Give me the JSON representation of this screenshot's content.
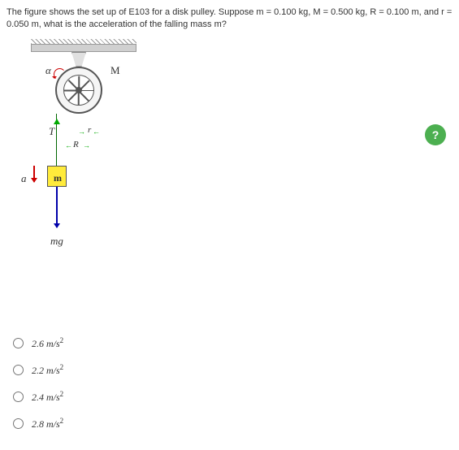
{
  "question": "The figure shows the set up of E103 for a disk pulley.  Suppose m = 0.100 kg, M = 0.500 kg, R = 0.100 m, and r = 0.050 m, what is the acceleration of the falling mass m?",
  "labels": {
    "alpha": "α",
    "M": "M",
    "T": "T",
    "r": "r",
    "R": "R",
    "a": "a",
    "m": "m",
    "mg": "mg"
  },
  "help": "?",
  "options": [
    {
      "value": "2.6",
      "unit": "m/s",
      "exp": "2"
    },
    {
      "value": "2.2",
      "unit": "m/s",
      "exp": "2"
    },
    {
      "value": "2.4",
      "unit": "m/s",
      "exp": "2"
    },
    {
      "value": "2.8",
      "unit": "m/s",
      "exp": "2"
    }
  ]
}
